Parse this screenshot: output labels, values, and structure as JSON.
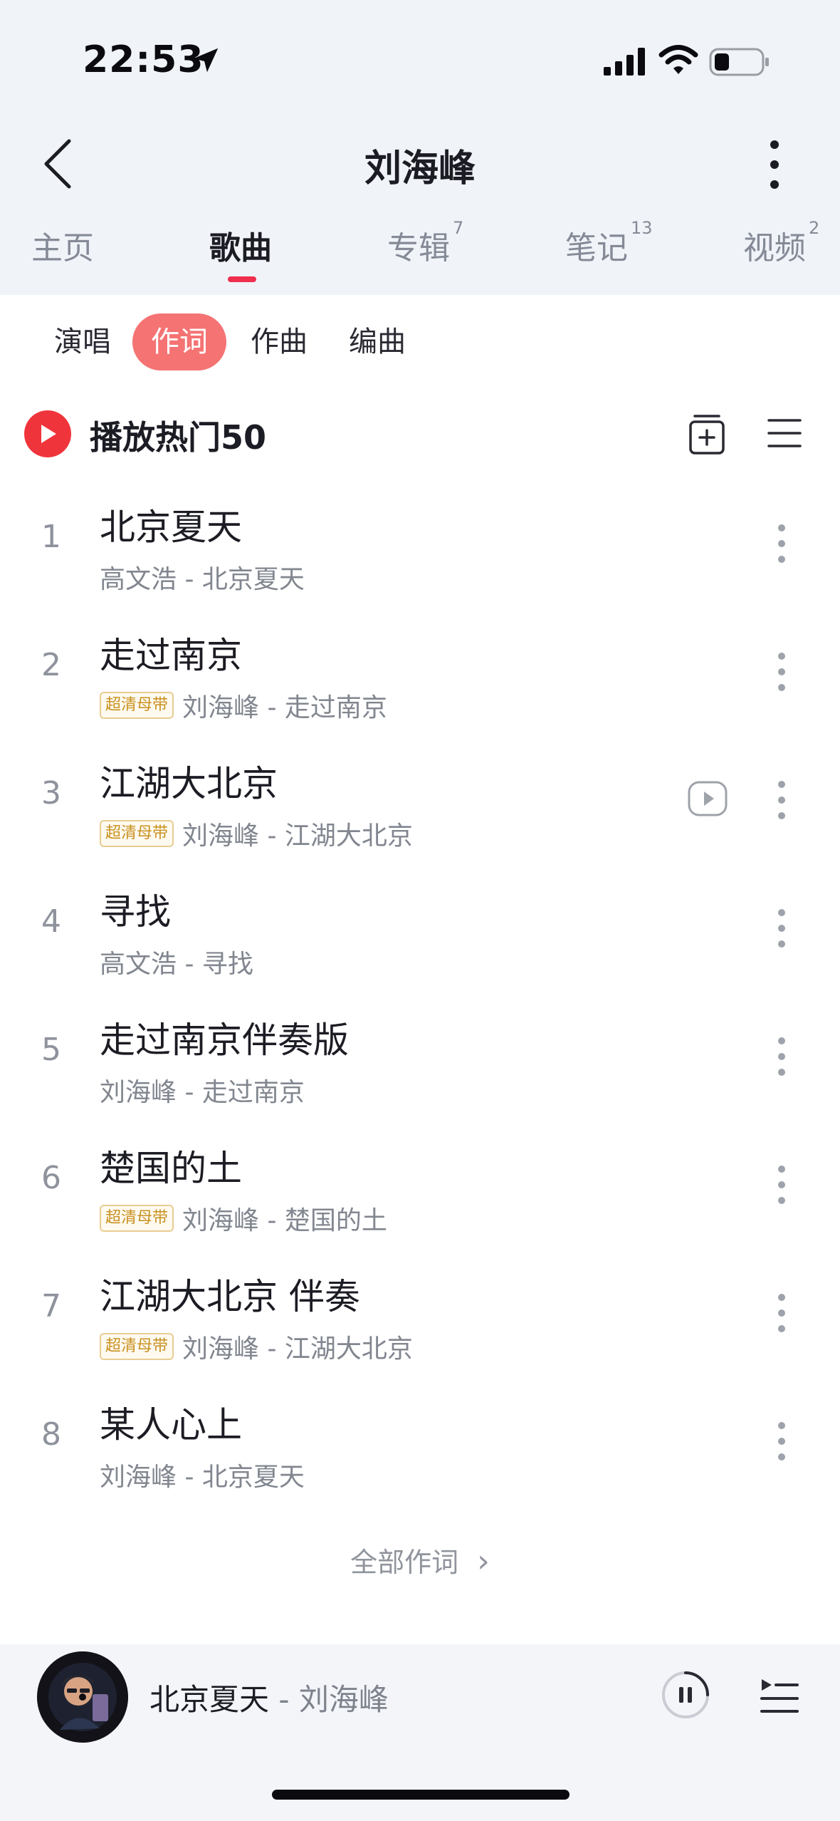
{
  "status_bar": {
    "time": "22:53",
    "icons": [
      "location-arrow-icon",
      "signal-icon",
      "wifi-icon",
      "battery-icon"
    ]
  },
  "header": {
    "title": "刘海峰",
    "back_icon": "chevron-left-icon",
    "more_icon": "vertical-dots-icon"
  },
  "tabs": [
    {
      "label": "主页",
      "count": ""
    },
    {
      "label": "歌曲",
      "count": ""
    },
    {
      "label": "专辑",
      "count": "7"
    },
    {
      "label": "笔记",
      "count": "13"
    },
    {
      "label": "视频",
      "count": "2"
    }
  ],
  "active_tab": "歌曲",
  "filters": [
    "演唱",
    "作词",
    "作曲",
    "编曲"
  ],
  "active_filter": "作词",
  "play_hot": {
    "label": "播放热门50"
  },
  "songs": [
    {
      "rank": "1",
      "title": "北京夏天",
      "badge": "",
      "meta": "高文浩 - 北京夏天",
      "mv": false
    },
    {
      "rank": "2",
      "title": "走过南京",
      "badge": "超清母带",
      "meta": "刘海峰 - 走过南京",
      "mv": false
    },
    {
      "rank": "3",
      "title": "江湖大北京",
      "badge": "超清母带",
      "meta": "刘海峰 - 江湖大北京",
      "mv": true
    },
    {
      "rank": "4",
      "title": "寻找",
      "badge": "",
      "meta": "高文浩 - 寻找",
      "mv": false
    },
    {
      "rank": "5",
      "title": "走过南京伴奏版",
      "badge": "",
      "meta": "刘海峰 - 走过南京",
      "mv": false
    },
    {
      "rank": "6",
      "title": "楚国的土",
      "badge": "超清母带",
      "meta": "刘海峰 - 楚国的土",
      "mv": false
    },
    {
      "rank": "7",
      "title": "江湖大北京 伴奏",
      "badge": "超清母带",
      "meta": "刘海峰 - 江湖大北京",
      "mv": false
    },
    {
      "rank": "8",
      "title": "某人心上",
      "badge": "",
      "meta": "刘海峰 - 北京夏天",
      "mv": false
    }
  ],
  "all_lyrics": {
    "label": "全部作词",
    "chevron": "›"
  },
  "mini_player": {
    "title": "北京夏天",
    "separator": " - ",
    "artist": "刘海峰",
    "state": "playing"
  },
  "colors": {
    "accent_red": "#ef2f4d",
    "chip_active": "#f57373",
    "play_button": "#f0343b",
    "badge_gold": "#c8901f"
  }
}
